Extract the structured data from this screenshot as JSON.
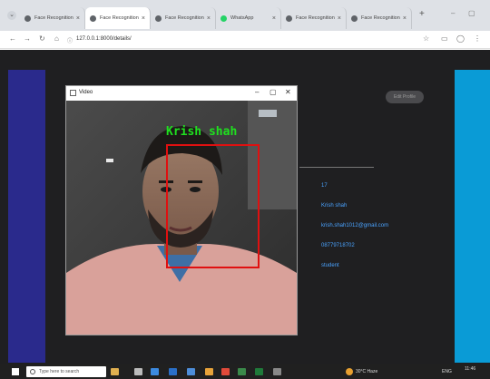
{
  "browser": {
    "tabs": [
      {
        "title": "Face Recognition",
        "active": false
      },
      {
        "title": "Face Recognition",
        "active": true
      },
      {
        "title": "Face Recognition",
        "active": false
      },
      {
        "title": "WhatsApp",
        "active": false
      },
      {
        "title": "Face Recognition",
        "active": false
      },
      {
        "title": "Face Recognition",
        "active": false
      }
    ],
    "url": "127.0.0.1:8000/details/"
  },
  "page": {
    "edit_button": "Edit Profile",
    "details": [
      "17",
      "Krish shah",
      "krish.shah1012@gmail.com",
      "08779718702",
      "student"
    ]
  },
  "video": {
    "window_title": "Video",
    "recognized_name": "Krish shah"
  },
  "taskbar": {
    "search_placeholder": "Type here to search",
    "weather": "30°C Haze",
    "lang": "ENG",
    "time": "11:46"
  },
  "colors": {
    "page_bg": "#1f1f21",
    "left_strip": "#2a2a8c",
    "right_strip": "#0a9bd6",
    "detail_text": "#4aa3ff",
    "face_box": "#e01010",
    "name_tag": "#1fe01f"
  }
}
